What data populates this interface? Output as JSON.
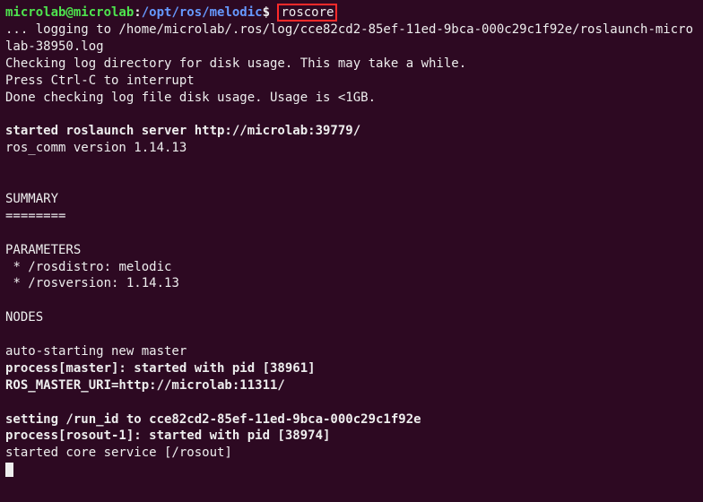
{
  "prompt": {
    "user": "microlab@microlab",
    "colon1": ":",
    "path": "/opt/ros/melodic",
    "dollar": "$",
    "command": "roscore"
  },
  "lines": {
    "l1": "... logging to /home/microlab/.ros/log/cce82cd2-85ef-11ed-9bca-000c29c1f92e/roslaunch-microlab-38950.log",
    "l2": "Checking log directory for disk usage. This may take a while.",
    "l3": "Press Ctrl-C to interrupt",
    "l4": "Done checking log file disk usage. Usage is <1GB.",
    "blank": "",
    "l5": "started roslaunch server http://microlab:39779/",
    "l6": "ros_comm version 1.14.13",
    "l7": "SUMMARY",
    "l8": "========",
    "l9": "PARAMETERS",
    "l10": " * /rosdistro: melodic",
    "l11": " * /rosversion: 1.14.13",
    "l12": "NODES",
    "l13": "auto-starting new master",
    "l14": "process[master]: started with pid [38961]",
    "l15": "ROS_MASTER_URI=http://microlab:11311/",
    "l16": "setting /run_id to cce82cd2-85ef-11ed-9bca-000c29c1f92e",
    "l17": "process[rosout-1]: started with pid [38974]",
    "l18": "started core service [/rosout]"
  }
}
